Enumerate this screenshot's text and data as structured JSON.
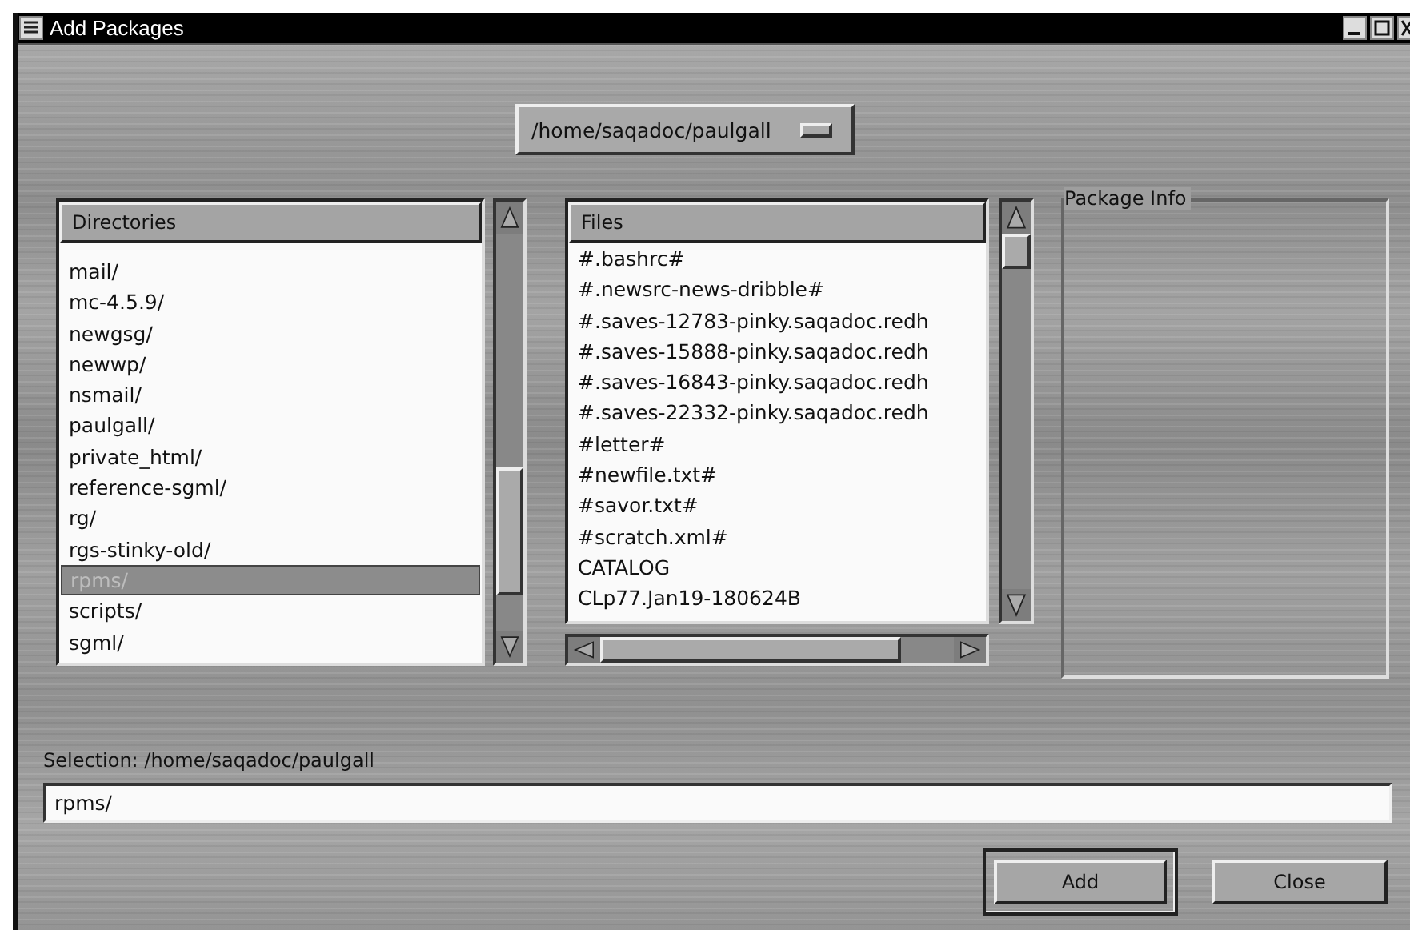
{
  "window": {
    "title": "Add Packages"
  },
  "path_selector": {
    "value": "/home/saqadoc/paulgall"
  },
  "directories": {
    "heading": "Directories",
    "items": [
      {
        "label": "mail/",
        "selected": false
      },
      {
        "label": "mc-4.5.9/",
        "selected": false
      },
      {
        "label": "newgsg/",
        "selected": false
      },
      {
        "label": "newwp/",
        "selected": false
      },
      {
        "label": "nsmail/",
        "selected": false
      },
      {
        "label": "paulgall/",
        "selected": false
      },
      {
        "label": "private_html/",
        "selected": false
      },
      {
        "label": "reference-sgml/",
        "selected": false
      },
      {
        "label": "rg/",
        "selected": false
      },
      {
        "label": "rgs-stinky-old/",
        "selected": false
      },
      {
        "label": "rpms/",
        "selected": true
      },
      {
        "label": "scripts/",
        "selected": false
      },
      {
        "label": "sgml/",
        "selected": false
      }
    ]
  },
  "files": {
    "heading": "Files",
    "items": [
      "#.bashrc#",
      "#.newsrc-news-dribble#",
      "#.saves-12783-pinky.saqadoc.redh",
      "#.saves-15888-pinky.saqadoc.redh",
      "#.saves-16843-pinky.saqadoc.redh",
      "#.saves-22332-pinky.saqadoc.redh",
      "#letter#",
      "#newfile.txt#",
      "#savor.txt#",
      "#scratch.xml#",
      "CATALOG",
      "CLp77.Jan19-180624B"
    ]
  },
  "package_info": {
    "title": "Package Info"
  },
  "selection": {
    "label": "Selection: /home/saqadoc/paulgall",
    "value": "rpms/"
  },
  "buttons": [
    {
      "label": "Add",
      "default": true
    },
    {
      "label": "Close",
      "default": false
    }
  ]
}
